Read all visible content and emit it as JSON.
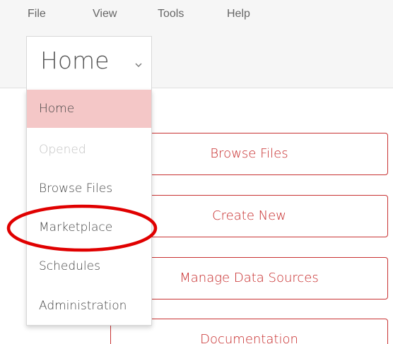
{
  "menubar": {
    "items": [
      "File",
      "View",
      "Tools",
      "Help"
    ]
  },
  "perspective": {
    "current": "Home",
    "chevron_icon": "chevron-down-icon"
  },
  "dropdown": {
    "items": [
      {
        "label": "Home",
        "state": "selected"
      },
      {
        "label": "Opened",
        "state": "disabled"
      },
      {
        "label": "Browse Files",
        "state": "normal"
      },
      {
        "label": "Marketplace",
        "state": "normal"
      },
      {
        "label": "Schedules",
        "state": "normal"
      },
      {
        "label": "Administration",
        "state": "normal"
      }
    ]
  },
  "main": {
    "buttons": [
      {
        "label": "Browse Files"
      },
      {
        "label": "Create New"
      },
      {
        "label": "Manage Data Sources"
      },
      {
        "label": "Documentation"
      }
    ]
  },
  "colors": {
    "accent": "#c62828",
    "selected_bg": "#f4c7c7",
    "annotation": "#e00000"
  }
}
